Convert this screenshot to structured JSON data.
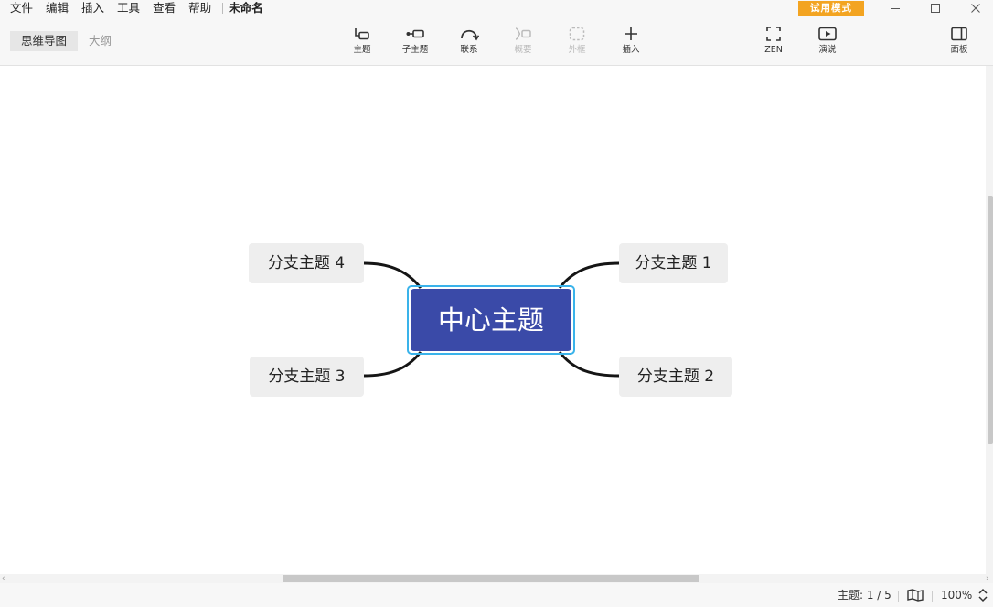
{
  "menubar": {
    "items": [
      "文件",
      "编辑",
      "插入",
      "工具",
      "查看",
      "帮助"
    ],
    "doc_title": "未命名"
  },
  "trial_badge": "试用模式",
  "view_tabs": {
    "mindmap": "思维导图",
    "outline": "大纲",
    "active": "mindmap"
  },
  "toolbar": {
    "topic": "主题",
    "subtopic": "子主题",
    "relationship": "联系",
    "summary": "概要",
    "boundary": "外框",
    "insert": "插入",
    "zen": "ZEN",
    "pitch": "演说",
    "panel": "面板"
  },
  "map": {
    "central": "中心主题",
    "branches": [
      "分支主题 1",
      "分支主题 2",
      "分支主题 3",
      "分支主题 4"
    ]
  },
  "status": {
    "topics": "主题: 1 / 5",
    "zoom": "100%"
  },
  "colors": {
    "central_fill": "#3a4aa8",
    "selection": "#3ab3ea",
    "branch_fill": "#eeeeee",
    "trial_badge": "#f3a421"
  }
}
